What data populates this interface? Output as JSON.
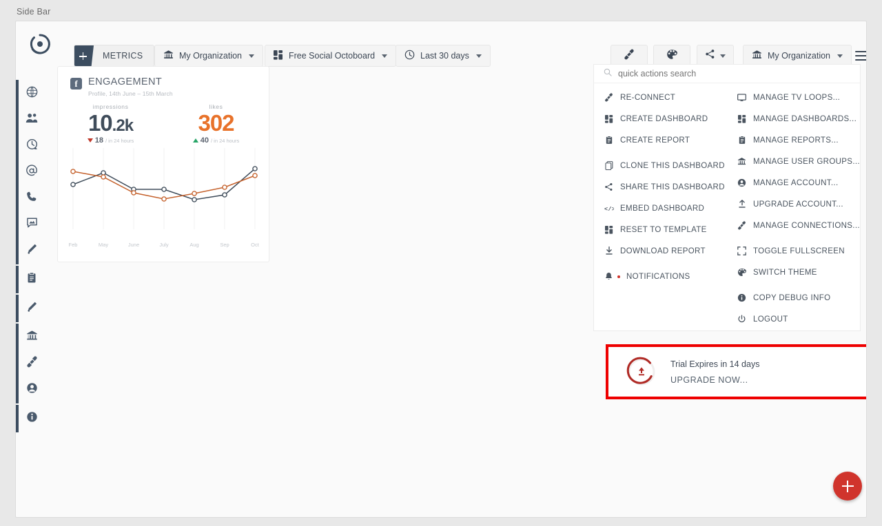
{
  "window_label": "Side Bar",
  "toolbar": {
    "logo_icon": "octoboard-logo-icon",
    "metrics_button": {
      "label": "METRICS",
      "icon": "plus-icon"
    },
    "organization_selector": {
      "label": "My Organization",
      "icon": "bank-icon"
    },
    "dashboard_selector": {
      "label": "Free Social Octoboard",
      "icon": "dashboard-grid-icon"
    },
    "date_selector": {
      "label": "Last 30 days",
      "icon": "clock-icon"
    },
    "plug_button": {
      "icon": "plug-icon"
    },
    "theme_button": {
      "icon": "palette-icon"
    },
    "share_button": {
      "icon": "share-icon"
    },
    "organization_selector_right": {
      "label": "My Organization",
      "icon": "bank-icon"
    },
    "menu_button": {
      "icon": "hamburger-icon"
    }
  },
  "sidebar": {
    "items": [
      {
        "icon": "globe-icon",
        "active": true
      },
      {
        "icon": "people-icon",
        "active": true
      },
      {
        "icon": "history-clock-icon",
        "active": true
      },
      {
        "icon": "at-mention-icon",
        "active": true
      },
      {
        "icon": "phone-icon",
        "active": true
      },
      {
        "icon": "chat-image-icon",
        "active": true
      },
      {
        "icon": "pen-icon",
        "active": true
      },
      {
        "icon": "clipboard-icon",
        "active": true
      },
      {
        "icon": "magic-wand-icon",
        "active": true
      },
      {
        "icon": "bank-icon",
        "active": true
      },
      {
        "icon": "plug-icon",
        "active": true
      },
      {
        "icon": "account-icon",
        "active": true
      },
      {
        "icon": "info-icon",
        "active": true
      }
    ]
  },
  "card": {
    "source_badge": "facebook-icon",
    "title": "ENGAGEMENT",
    "subtitle": "Profile, 14th June – 15th March",
    "kpis": [
      {
        "label": "impressions",
        "value": "10",
        "suffix": ".2k",
        "delta": "18",
        "delta_direction": "down",
        "delta_unit": "/ in 24 hours",
        "color": "#3f4c5a"
      },
      {
        "label": "likes",
        "value": "302",
        "suffix": "",
        "delta": "40",
        "delta_direction": "up",
        "delta_unit": "/ in 24 hours",
        "color": "#e8722a"
      }
    ]
  },
  "chart_data": {
    "type": "line",
    "title": "ENGAGEMENT",
    "xlabel": "",
    "ylabel": "",
    "grid": true,
    "legend_position": "none",
    "categories": [
      "Feb",
      "May",
      "June",
      "July",
      "Aug",
      "Sep",
      "Oct"
    ],
    "ylim": [
      0,
      100
    ],
    "series": [
      {
        "name": "impressions",
        "color": "#3f4c5a",
        "values": [
          55,
          72,
          48,
          48,
          33,
          40,
          78
        ]
      },
      {
        "name": "likes",
        "color": "#c5622d",
        "values": [
          74,
          66,
          43,
          34,
          42,
          51,
          68
        ]
      }
    ]
  },
  "quick_actions": {
    "search_placeholder": "quick actions search",
    "search_value": "",
    "search_icon": "search-icon",
    "left_column": [
      {
        "label": "RE-CONNECT",
        "icon": "plug-icon",
        "gap": false
      },
      {
        "label": "CREATE DASHBOARD",
        "icon": "dashboard-grid-icon",
        "gap": false
      },
      {
        "label": "CREATE REPORT",
        "icon": "clipboard-icon",
        "gap": false
      },
      {
        "label": "CLONE THIS DASHBOARD",
        "icon": "copy-icon",
        "gap": true
      },
      {
        "label": "SHARE THIS DASHBOARD",
        "icon": "share-icon",
        "gap": false
      },
      {
        "label": "EMBED DASHBOARD",
        "icon": "code-icon",
        "gap": false
      },
      {
        "label": "RESET TO TEMPLATE",
        "icon": "dashboard-grid-icon",
        "gap": false
      },
      {
        "label": "DOWNLOAD REPORT",
        "icon": "download-icon",
        "gap": false
      },
      {
        "label": "NOTIFICATIONS",
        "icon": "bell-icon",
        "gap": true,
        "badge": true
      }
    ],
    "right_column": [
      {
        "label": "MANAGE TV LOOPS...",
        "icon": "monitor-icon",
        "gap": false
      },
      {
        "label": "MANAGE DASHBOARDS...",
        "icon": "dashboard-grid-icon",
        "gap": false
      },
      {
        "label": "MANAGE REPORTS...",
        "icon": "clipboard-icon",
        "gap": false
      },
      {
        "label": "MANAGE USER GROUPS...",
        "icon": "bank-icon",
        "gap": false
      },
      {
        "label": "MANAGE ACCOUNT...",
        "icon": "account-icon",
        "gap": false
      },
      {
        "label": "UPGRADE ACCOUNT...",
        "icon": "upload-icon",
        "gap": false
      },
      {
        "label": "MANAGE CONNECTIONS...",
        "icon": "plug-icon",
        "gap": false
      },
      {
        "label": "TOGGLE FULLSCREEN",
        "icon": "fullscreen-icon",
        "gap": true
      },
      {
        "label": "SWITCH THEME",
        "icon": "palette-icon",
        "gap": false
      },
      {
        "label": "COPY DEBUG INFO",
        "icon": "info-icon",
        "gap": true
      },
      {
        "label": "LOGOUT",
        "icon": "power-icon",
        "gap": false
      }
    ]
  },
  "trial_banner": {
    "title": "Trial Expires in 14 days",
    "cta": "UPGRADE NOW...",
    "icon": "upgrade-ring-icon",
    "highlight_color": "#ee0000",
    "ring_color": "#b02a25"
  },
  "fab": {
    "icon": "plus-icon",
    "color": "#d0342c"
  }
}
